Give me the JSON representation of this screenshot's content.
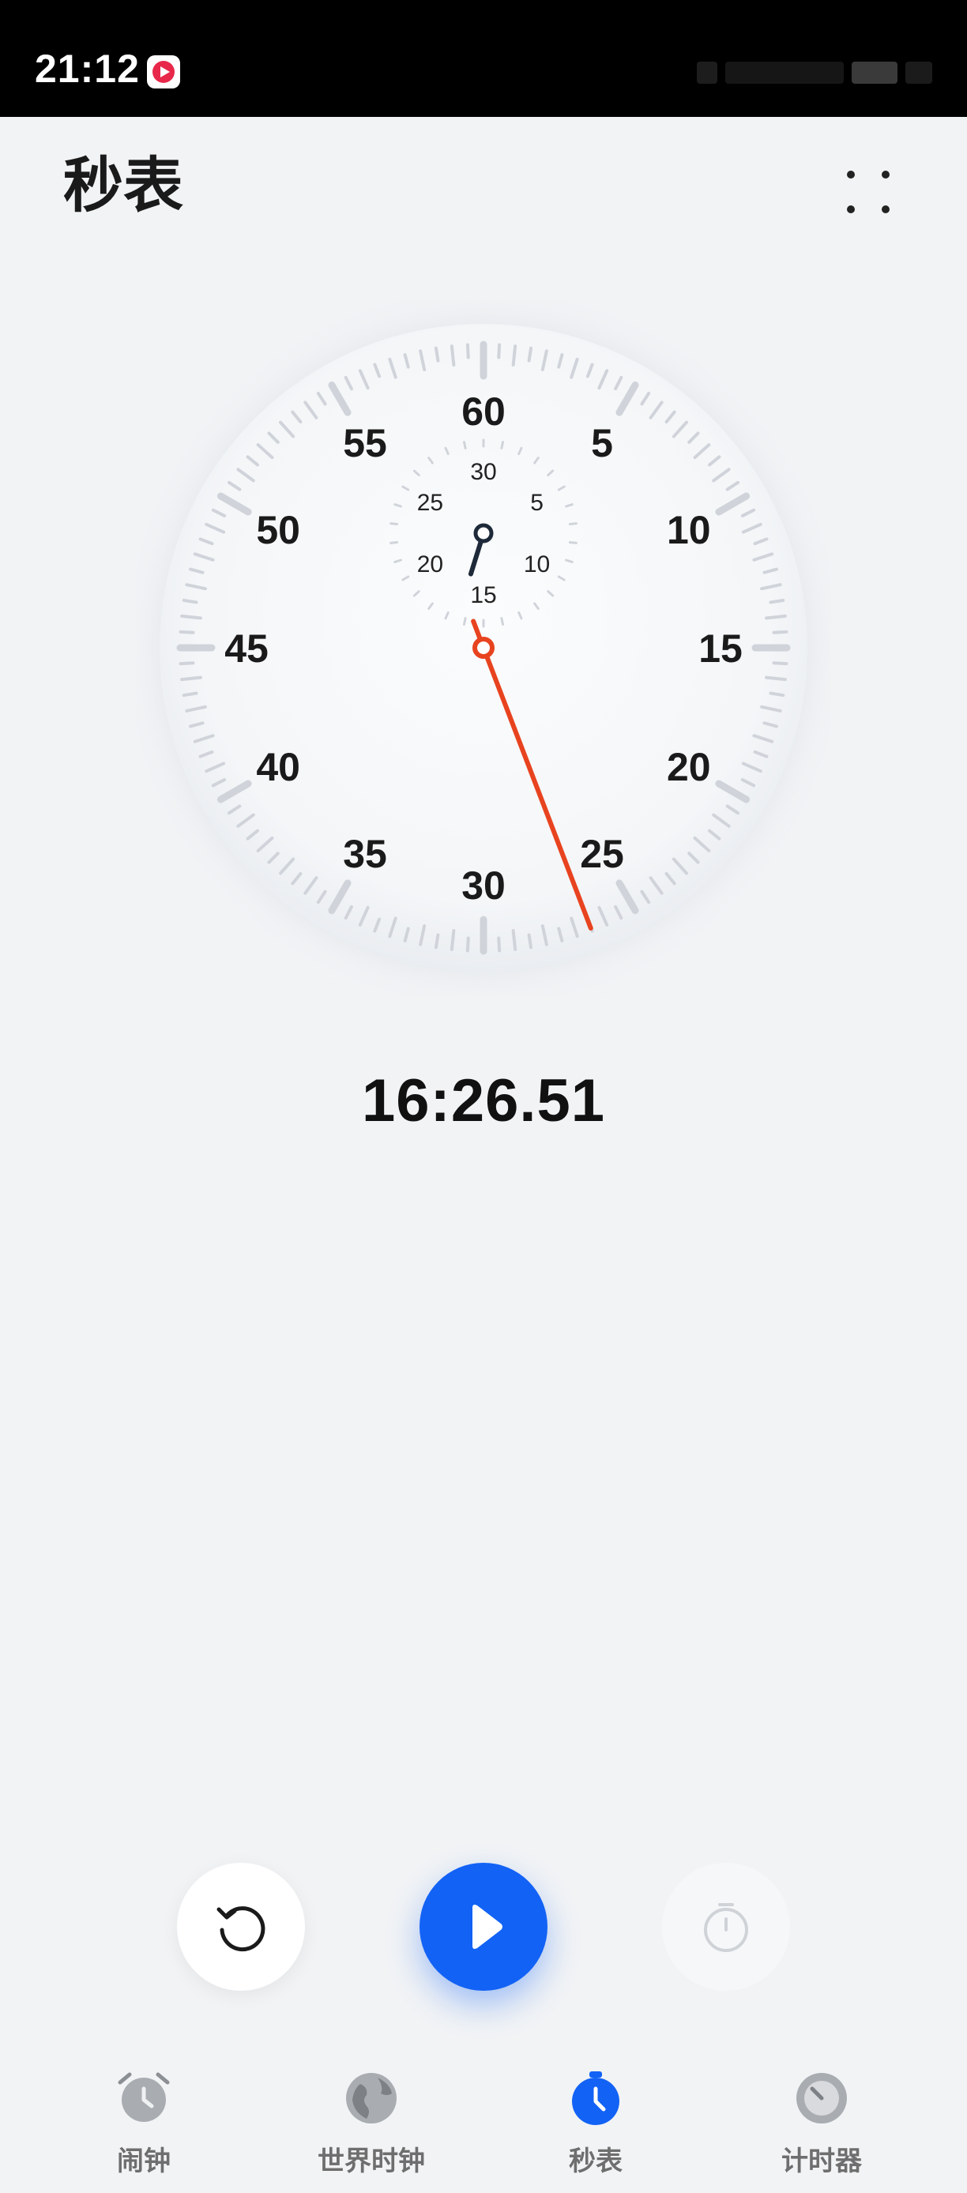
{
  "status_bar": {
    "time": "21:12"
  },
  "header": {
    "title": "秒表"
  },
  "dial": {
    "seconds_labels": [
      "60",
      "5",
      "10",
      "15",
      "20",
      "25",
      "30",
      "35",
      "40",
      "45",
      "50",
      "55"
    ],
    "minutes_labels": [
      "30",
      "5",
      "10",
      "15",
      "20",
      "25"
    ],
    "accent_color": "#e8431f",
    "tick_color": "#d0d4da"
  },
  "stopwatch": {
    "elapsed": "16:26.51"
  },
  "controls": {
    "reset_icon": "reset-icon",
    "play_icon": "play-icon",
    "lap_icon": "lap-stopwatch-icon",
    "primary_color": "#1262f5"
  },
  "tabs": [
    {
      "label": "闹钟",
      "icon": "alarm-clock-icon",
      "active": false
    },
    {
      "label": "世界时钟",
      "icon": "globe-icon",
      "active": false
    },
    {
      "label": "秒表",
      "icon": "stopwatch-icon",
      "active": true
    },
    {
      "label": "计时器",
      "icon": "timer-icon",
      "active": false
    }
  ]
}
